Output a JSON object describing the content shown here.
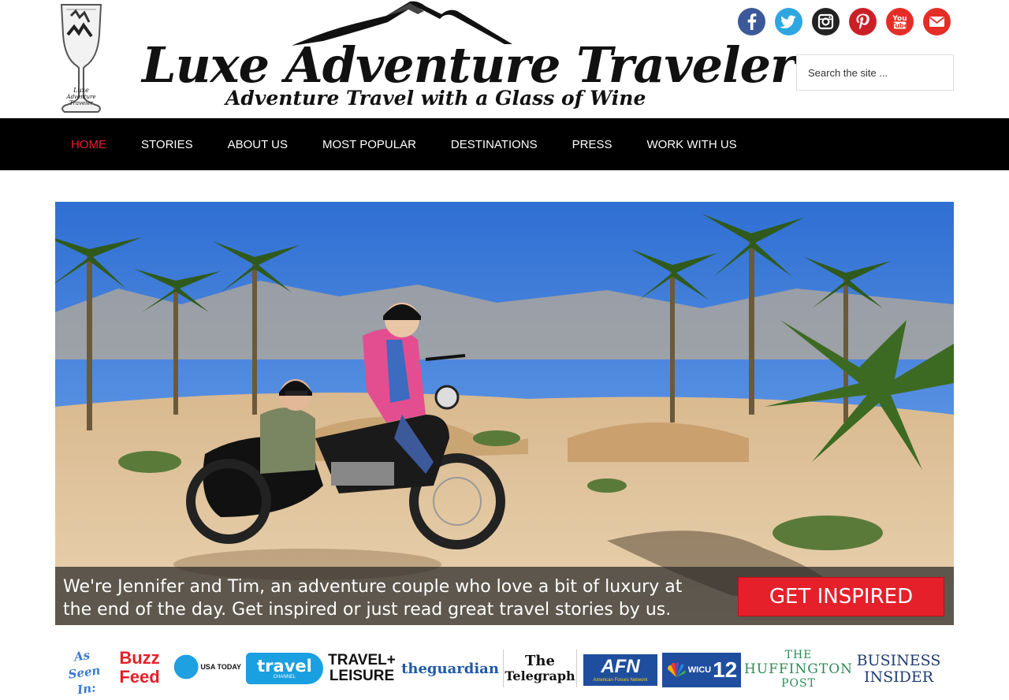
{
  "site": {
    "title": "Luxe Adventure Traveler",
    "tagline": "Adventure Travel with a Glass of Wine",
    "glass_text": [
      "Luxe",
      "Adventure",
      "Traveler"
    ]
  },
  "social": [
    {
      "name": "facebook",
      "icon": "facebook-icon",
      "color": "#3b5998"
    },
    {
      "name": "twitter",
      "icon": "twitter-icon",
      "color": "#2ea7e0"
    },
    {
      "name": "instagram",
      "icon": "instagram-icon",
      "color": "#222222"
    },
    {
      "name": "pinterest",
      "icon": "pinterest-icon",
      "color": "#cb2027"
    },
    {
      "name": "youtube",
      "icon": "youtube-icon",
      "color": "#e52d27"
    },
    {
      "name": "email",
      "icon": "envelope-icon",
      "color": "#e52d27"
    }
  ],
  "search": {
    "placeholder": "Search the site ..."
  },
  "nav": {
    "items": [
      {
        "label": "HOME",
        "active": true
      },
      {
        "label": "STORIES"
      },
      {
        "label": "ABOUT US"
      },
      {
        "label": "MOST POPULAR"
      },
      {
        "label": "DESTINATIONS"
      },
      {
        "label": "PRESS"
      },
      {
        "label": "WORK WITH US"
      }
    ],
    "active_color": "#e5202a"
  },
  "hero": {
    "caption": "We're Jennifer and Tim, an adventure couple who love a bit of luxury at the end of the day. Get inspired or just read great travel stories by us.",
    "cta": "GET INSPIRED",
    "cta_color": "#e5202a"
  },
  "press": {
    "label": "As Seen In:",
    "logos": {
      "buzzfeed": "Buzz Feed",
      "usatoday": "USA TODAY",
      "travel": "travel",
      "travel_sub": "CHANNEL",
      "tl_1": "TRAVEL+",
      "tl_2": "LEISURE",
      "guardian": "theguardian",
      "telegraph_1": "The",
      "telegraph_2": "Telegraph",
      "afn": "AFN",
      "afn_sub": "American Forces Network",
      "wicu": "WICU",
      "wicu_num": "12",
      "huff_1": "THE",
      "huff_2": "HUFFINGTON",
      "huff_3": "POST",
      "bi_1": "BUSINESS",
      "bi_2": "INSIDER"
    }
  }
}
